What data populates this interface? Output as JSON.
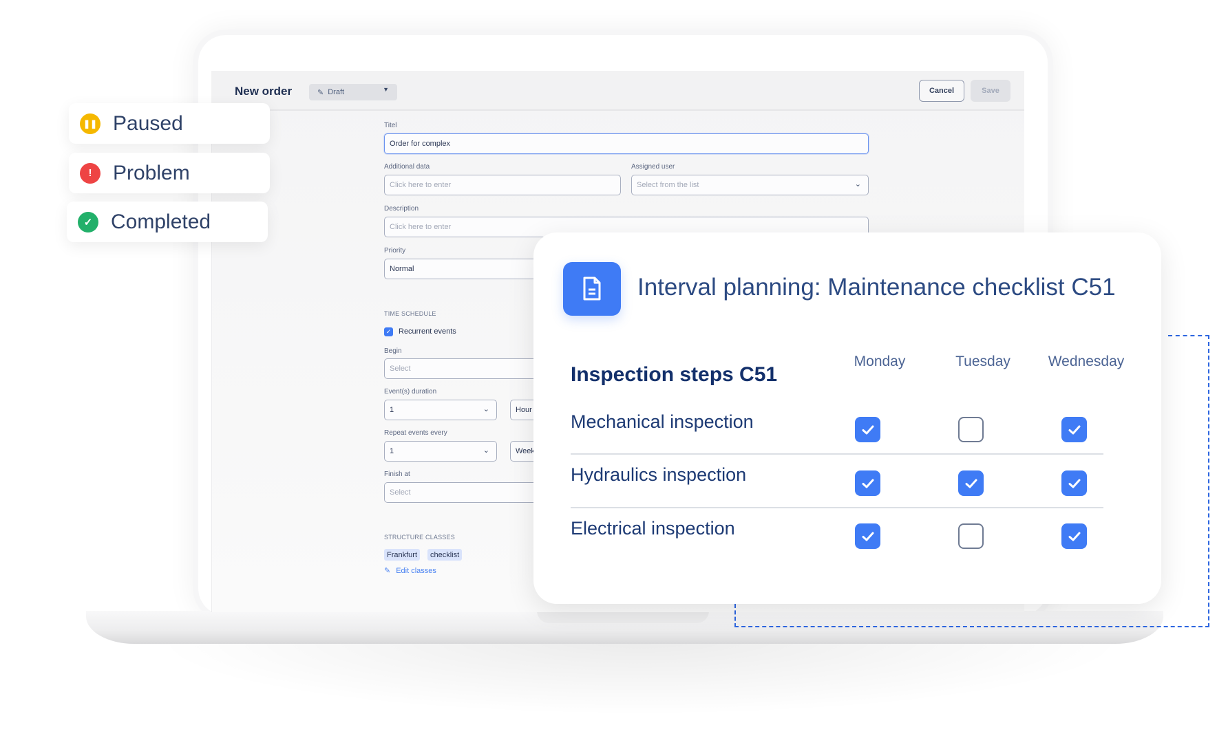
{
  "statuses": [
    {
      "label": "Paused",
      "icon": "pause-icon",
      "color": "#F5B800",
      "glyph": "II"
    },
    {
      "label": "Problem",
      "icon": "exclamation-icon",
      "color": "#EE4444",
      "glyph": "!"
    },
    {
      "label": "Completed",
      "icon": "check-icon",
      "color": "#22B06A",
      "glyph": "✓"
    }
  ],
  "header": {
    "title": "New order",
    "status_select": {
      "value": "Draft",
      "icon": "edit-icon"
    },
    "cancel_label": "Cancel",
    "save_label": "Save"
  },
  "form": {
    "title": {
      "label": "Titel",
      "value": "Order for complex"
    },
    "additional_data": {
      "label": "Additional data",
      "placeholder": "Click here to enter"
    },
    "assigned_user": {
      "label": "Assigned user",
      "placeholder": "Select from the list"
    },
    "description": {
      "label": "Description",
      "placeholder": "Click here to enter"
    },
    "priority": {
      "label": "Priority",
      "value": "Normal"
    },
    "time_schedule": {
      "heading": "TIME SCHEDULE",
      "recurrent_label": "Recurrent events",
      "recurrent_checked": true,
      "begin": {
        "label": "Begin",
        "placeholder": "Select"
      },
      "duration": {
        "label": "Event(s) duration",
        "value": "1",
        "unit": "Hour (s"
      },
      "repeat": {
        "label": "Repeat events every",
        "value": "1",
        "unit": "Week"
      },
      "finish": {
        "label": "Finish at",
        "placeholder": "Select"
      }
    },
    "structure_classes": {
      "heading": "STRUCTURE CLASSES",
      "tags": [
        "Frankfurt",
        "checklist"
      ],
      "edit_label": "Edit classes"
    }
  },
  "checklist_card": {
    "title": "Interval planning: Maintenance checklist C51",
    "icon": "document-icon",
    "steps_title": "Inspection steps C51",
    "days": [
      "Monday",
      "Tuesday",
      "Wednesday"
    ],
    "rows": [
      {
        "label": "Mechanical inspection",
        "checks": [
          true,
          false,
          true
        ]
      },
      {
        "label": "Hydraulics inspection",
        "checks": [
          true,
          true,
          true
        ]
      },
      {
        "label": "Electrical inspection",
        "checks": [
          true,
          false,
          true
        ]
      }
    ]
  },
  "colors": {
    "accent": "#3F7BF5",
    "text_dark": "#13306B"
  }
}
